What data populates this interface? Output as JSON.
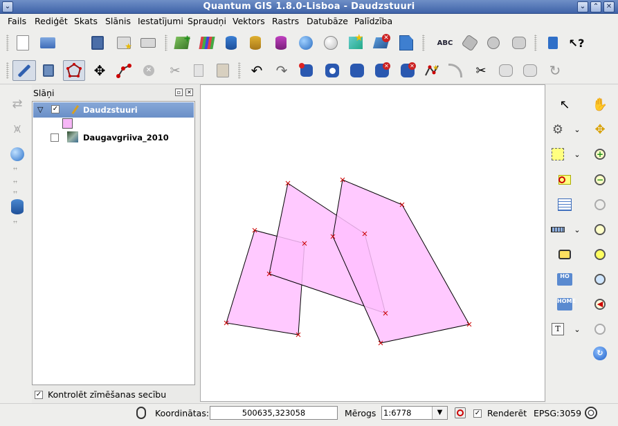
{
  "window": {
    "title": "Quantum GIS 1.8.0-Lisboa - Daudzstuuri"
  },
  "menu": [
    "Fails",
    "Rediģēt",
    "Skats",
    "Slānis",
    "Iestatījumi",
    "Spraudņi",
    "Vektors",
    "Rastrs",
    "Datubāze",
    "Palīdzība"
  ],
  "layers_panel": {
    "title": "Slāņi",
    "layers": [
      {
        "name": "Daudzstuuri",
        "checked": true,
        "selected": true,
        "symbol_color": "#f7b7f7"
      },
      {
        "name": "Daugavgriiva_2010",
        "checked": false,
        "selected": false
      }
    ],
    "drawing_order_label": "Kontrolēt zīmēšanas secību",
    "drawing_order_checked": true
  },
  "map": {
    "polygon_fill": "#ffc0ff",
    "polygon_stroke": "#000000",
    "vertex_color": "#cc0000"
  },
  "status": {
    "coord_label": "Koordinātas:",
    "coord_value": "500635,323058",
    "scale_label": "Mērogs",
    "scale_value": "1:6778",
    "render_label": "Renderēt",
    "render_checked": true,
    "crs": "EPSG:3059"
  },
  "icons": {
    "toolbar1": [
      "new-project-icon",
      "open-project-icon",
      "save-project-icon",
      "save-as-icon",
      "print-icon",
      "add-vector-layer-icon",
      "add-raster-layer-icon",
      "add-postgis-layer-icon",
      "add-spatialite-layer-icon",
      "add-mssql-layer-icon",
      "add-wms-layer-icon",
      "add-wfs-layer-icon",
      "new-shapefile-layer-icon",
      "remove-layer-icon",
      "new-gpx-layer-icon",
      "spell-check-icon",
      "plugin-icon",
      "plugin-manager-icon",
      "python-icon",
      "help-book-icon",
      "whats-this-icon"
    ],
    "toolbar2": [
      "toggle-editing-icon",
      "save-edits-icon",
      "add-feature-icon",
      "move-feature-icon",
      "node-tool-icon",
      "delete-selected-icon",
      "cut-features-icon",
      "copy-features-icon",
      "paste-features-icon",
      "undo-icon",
      "redo-icon",
      "simplify-feature-icon",
      "add-ring-icon",
      "add-part-icon",
      "delete-ring-icon",
      "delete-part-icon",
      "reshape-feature-icon",
      "offset-curve-icon",
      "split-features-icon",
      "merge-features-icon",
      "merge-attributes-icon",
      "rotate-symbols-icon"
    ]
  }
}
